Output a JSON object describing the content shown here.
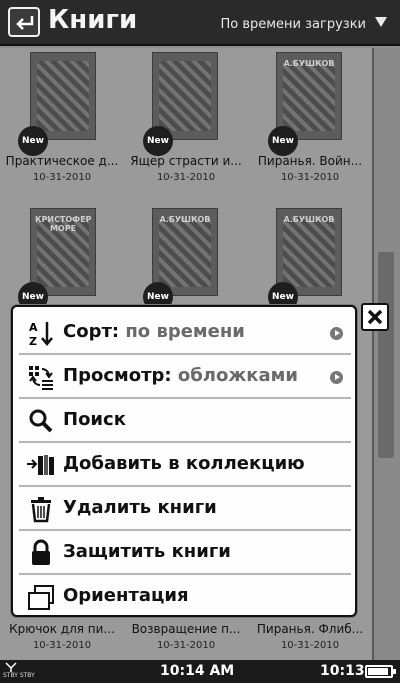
{
  "header": {
    "title": "Книги",
    "sort_label": "По времени загрузки"
  },
  "books": [
    {
      "title": "Практическое д...",
      "date": "10-31-2010",
      "badge": "New",
      "cover_text": ""
    },
    {
      "title": "Ящер страсти и...",
      "date": "10-31-2010",
      "badge": "New",
      "cover_text": ""
    },
    {
      "title": "Пиранья. Войн...",
      "date": "10-31-2010",
      "badge": "New",
      "cover_text": "А.БУШКОВ"
    },
    {
      "title": "",
      "date": "",
      "badge": "New",
      "cover_text": "КРИСТОФЕР МОРЕ"
    },
    {
      "title": "",
      "date": "",
      "badge": "New",
      "cover_text": "А.БУШКОВ"
    },
    {
      "title": "",
      "date": "",
      "badge": "New",
      "cover_text": "А.БУШКОВ"
    },
    {
      "title": "Крючок для пи...",
      "date": "10-31-2010",
      "badge": "",
      "cover_text": ""
    },
    {
      "title": "Возвращение п...",
      "date": "10-31-2010",
      "badge": "",
      "cover_text": ""
    },
    {
      "title": "Пиранья. Флиб...",
      "date": "10-31-2010",
      "badge": "",
      "cover_text": ""
    }
  ],
  "menu": {
    "sort": {
      "label": "Сорт:",
      "value": "по времени",
      "icon": "sort-az-icon"
    },
    "view": {
      "label": "Просмотр:",
      "value": "обложками",
      "icon": "view-switch-icon"
    },
    "search": {
      "label": "Поиск",
      "icon": "search-icon"
    },
    "add_collection": {
      "label": "Добавить в коллекцию",
      "icon": "add-to-collection-icon"
    },
    "delete": {
      "label": "Удалить книги",
      "icon": "trash-icon"
    },
    "protect": {
      "label": "Защитить книги",
      "icon": "lock-icon"
    },
    "orientation": {
      "label": "Ориентация",
      "icon": "orientation-icon"
    }
  },
  "status": {
    "standby": "STBY STBY",
    "time_center": "10:14 AM",
    "time_right": "10:13",
    "battery_level": 0.9
  }
}
